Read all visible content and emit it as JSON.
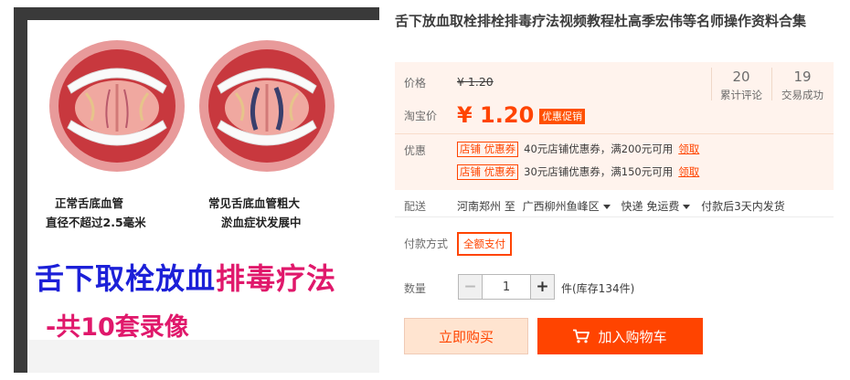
{
  "gallery": {
    "caption_left_1": "正常舌底血管",
    "caption_left_2": "直径不超过2.5毫米",
    "caption_right_1": "常见舌底血管粗大",
    "caption_right_2": "淤血症状发展中",
    "promo_line_1a": "舌下取栓放血",
    "promo_line_1b": "排毒疗法",
    "promo_line_2": "-共10套录像"
  },
  "product": {
    "title": "舌下放血取栓排栓排毒疗法视频教程杜高季宏伟等名师操作资料合集"
  },
  "price": {
    "label": "价格",
    "original": "¥ 1.20",
    "taobao_label": "淘宝价",
    "current": "¥ 1.20",
    "promo_badge": "优惠促销"
  },
  "stats": {
    "reviews_count": "20",
    "reviews_label": "累计评论",
    "sales_count": "19",
    "sales_label": "交易成功"
  },
  "coupons": {
    "label": "优惠",
    "items": [
      {
        "tag": "店铺 优惠券",
        "text": "40元店铺优惠券，满200元可用",
        "link": "领取"
      },
      {
        "tag": "店铺 优惠券",
        "text": "30元店铺优惠券，满150元可用",
        "link": "领取"
      }
    ]
  },
  "shipping": {
    "label": "配送",
    "from": "河南郑州 至",
    "to": "广西柳州鱼峰区",
    "method": "快递 免运费",
    "time": "付款后3天内发货"
  },
  "payment": {
    "label": "付款方式",
    "option": "全额支付"
  },
  "quantity": {
    "label": "数量",
    "minus": "−",
    "value": "1",
    "plus": "+",
    "stock": "件(库存134件)"
  },
  "actions": {
    "buy_now": "立即购买",
    "add_to_cart": "加入购物车",
    "cart_icon": "shopping-cart-icon"
  },
  "colors": {
    "accent": "#ff4400",
    "price_bg": "#fff3ed"
  }
}
